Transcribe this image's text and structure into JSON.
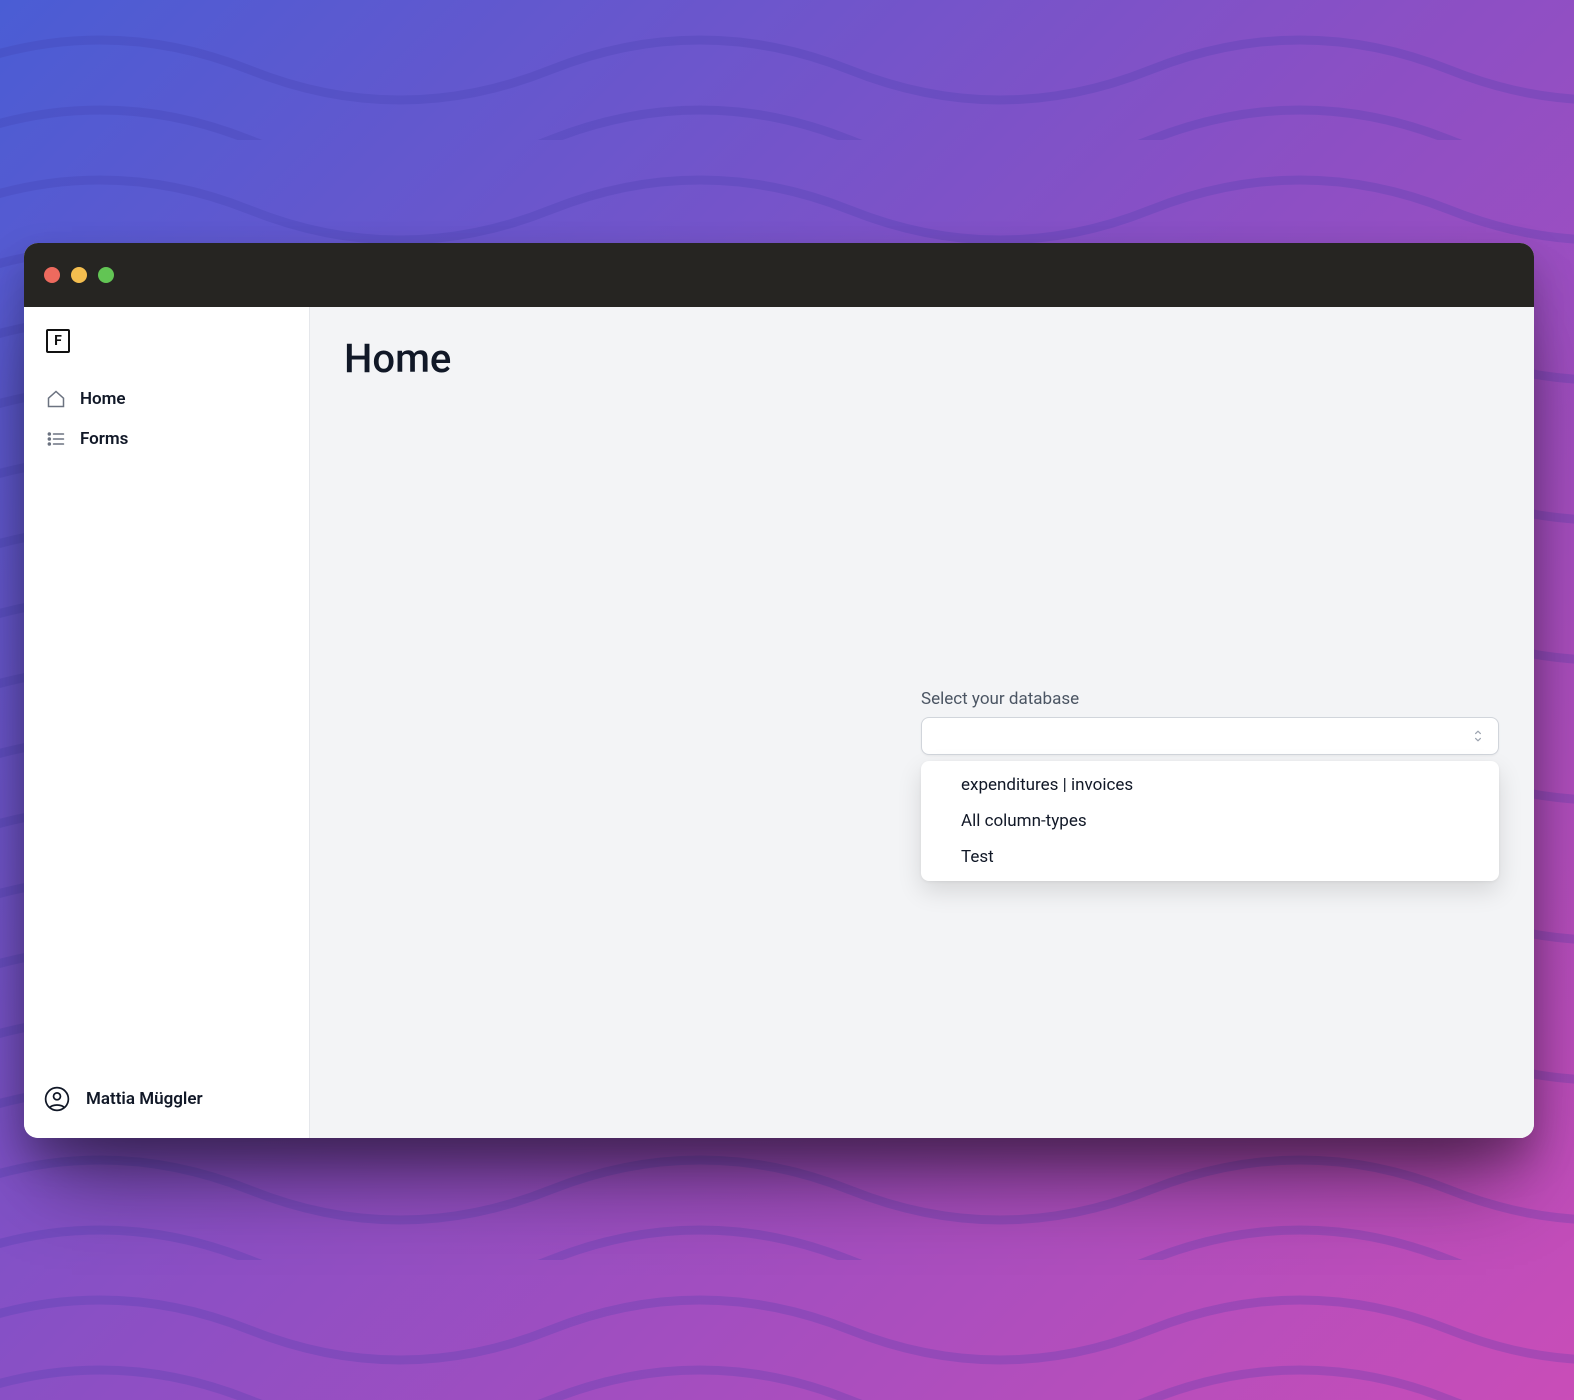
{
  "logo_letter": "F",
  "sidebar": {
    "items": [
      {
        "label": "Home",
        "icon": "home-icon"
      },
      {
        "label": "Forms",
        "icon": "list-icon"
      }
    ]
  },
  "user": {
    "name": "Mattia Müggler"
  },
  "page": {
    "title": "Home"
  },
  "select": {
    "label": "Select your database",
    "value": "",
    "options": [
      "expenditures | invoices",
      "All column-types",
      "Test"
    ]
  }
}
